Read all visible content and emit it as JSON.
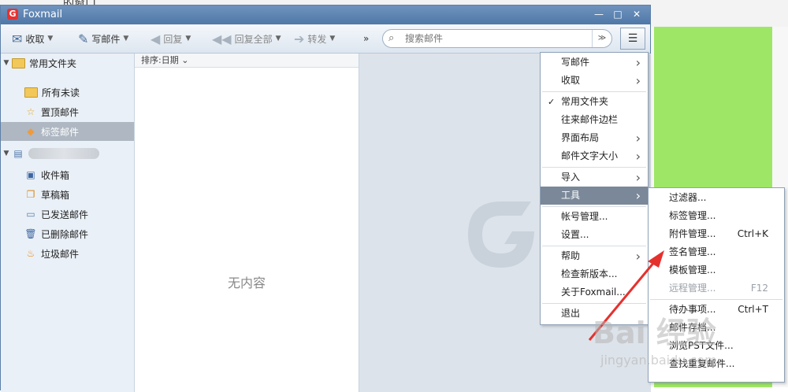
{
  "background": {
    "top_text": "的窗口",
    "green_color": "#9ee766"
  },
  "window": {
    "title": "Foxmail",
    "controls": [
      "—",
      "□",
      "✕"
    ]
  },
  "toolbar": {
    "receive": "收取",
    "compose": "写邮件",
    "reply": "回复",
    "reply_all": "回复全部",
    "forward": "转发",
    "more": "»",
    "search_placeholder": "搜索邮件",
    "search_dropdown": "≫"
  },
  "sidebar": {
    "common_folders": "常用文件夹",
    "all_unread": "所有未读",
    "starred": "置顶邮件",
    "tagged": "标签邮件",
    "inbox": "收件箱",
    "drafts": "草稿箱",
    "sent": "已发送邮件",
    "deleted": "已删除邮件",
    "junk": "垃圾邮件"
  },
  "list": {
    "sort_label": "排序:日期 ⌄",
    "empty": "无内容"
  },
  "main_menu": [
    {
      "label": "写邮件",
      "submenu": true
    },
    {
      "label": "收取",
      "submenu": true
    },
    {
      "label": "常用文件夹",
      "checked": true
    },
    {
      "label": "往来邮件边栏"
    },
    {
      "label": "界面布局",
      "submenu": true
    },
    {
      "label": "邮件文字大小",
      "submenu": true
    },
    {
      "label": "导入",
      "submenu": true
    },
    {
      "label": "工具",
      "submenu": true,
      "highlighted": true
    },
    {
      "label": "帐号管理..."
    },
    {
      "label": "设置..."
    },
    {
      "label": "帮助",
      "submenu": true
    },
    {
      "label": "检查新版本..."
    },
    {
      "label": "关于Foxmail..."
    },
    {
      "label": "退出"
    }
  ],
  "tools_menu": [
    {
      "label": "过滤器..."
    },
    {
      "label": "标签管理..."
    },
    {
      "label": "附件管理...",
      "shortcut": "Ctrl+K"
    },
    {
      "label": "签名管理..."
    },
    {
      "label": "模板管理..."
    },
    {
      "label": "远程管理...",
      "shortcut": "F12",
      "disabled": true
    },
    {
      "label": "待办事项...",
      "shortcut": "Ctrl+T"
    },
    {
      "label": "邮件存档..."
    },
    {
      "label": "浏览PST文件..."
    },
    {
      "label": "查找重复邮件..."
    }
  ],
  "watermark": {
    "logo": "Bai 经验",
    "url": "jingyan.baidu.com"
  }
}
